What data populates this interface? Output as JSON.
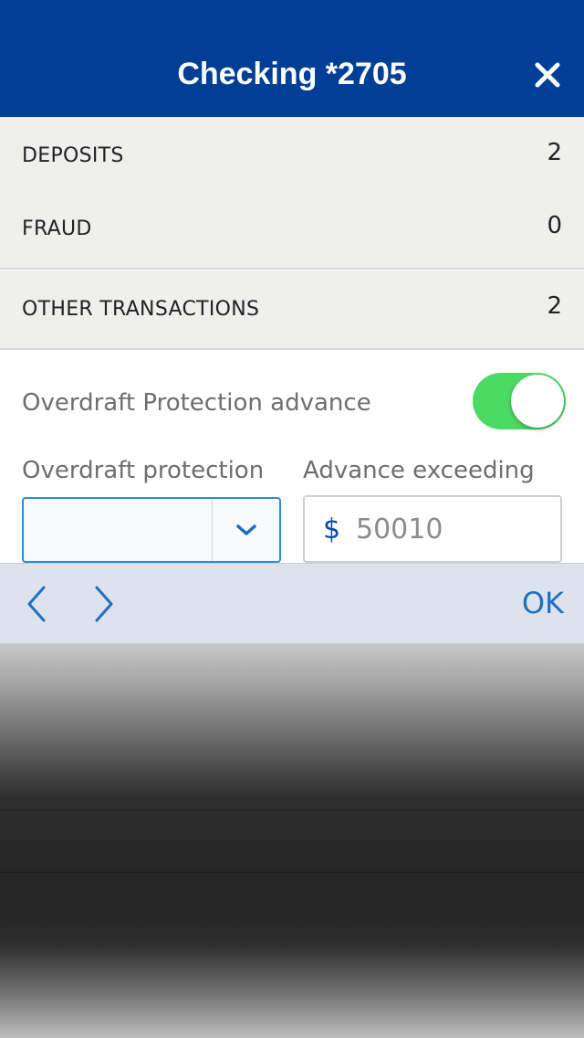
{
  "header": {
    "title": "Checking *2705",
    "close_icon": "close-icon",
    "background": "#003f95"
  },
  "categories": [
    {
      "label": "DEPOSITS",
      "count": "2"
    },
    {
      "label": "FRAUD",
      "count": "0"
    },
    {
      "label": "OTHER TRANSACTIONS",
      "count": "2"
    }
  ],
  "overdraft": {
    "toggle_label": "Overdraft Protection advance",
    "toggle_on": true,
    "toggle_color": "#4cd964",
    "protection_label": "Overdraft protection",
    "protection_value": "",
    "advance_label": "Advance exceeding",
    "currency_symbol": "$",
    "advance_value": "50010"
  },
  "toolbar": {
    "prev_icon": "chevron-left-icon",
    "next_icon": "chevron-right-icon",
    "ok_label": "OK"
  }
}
